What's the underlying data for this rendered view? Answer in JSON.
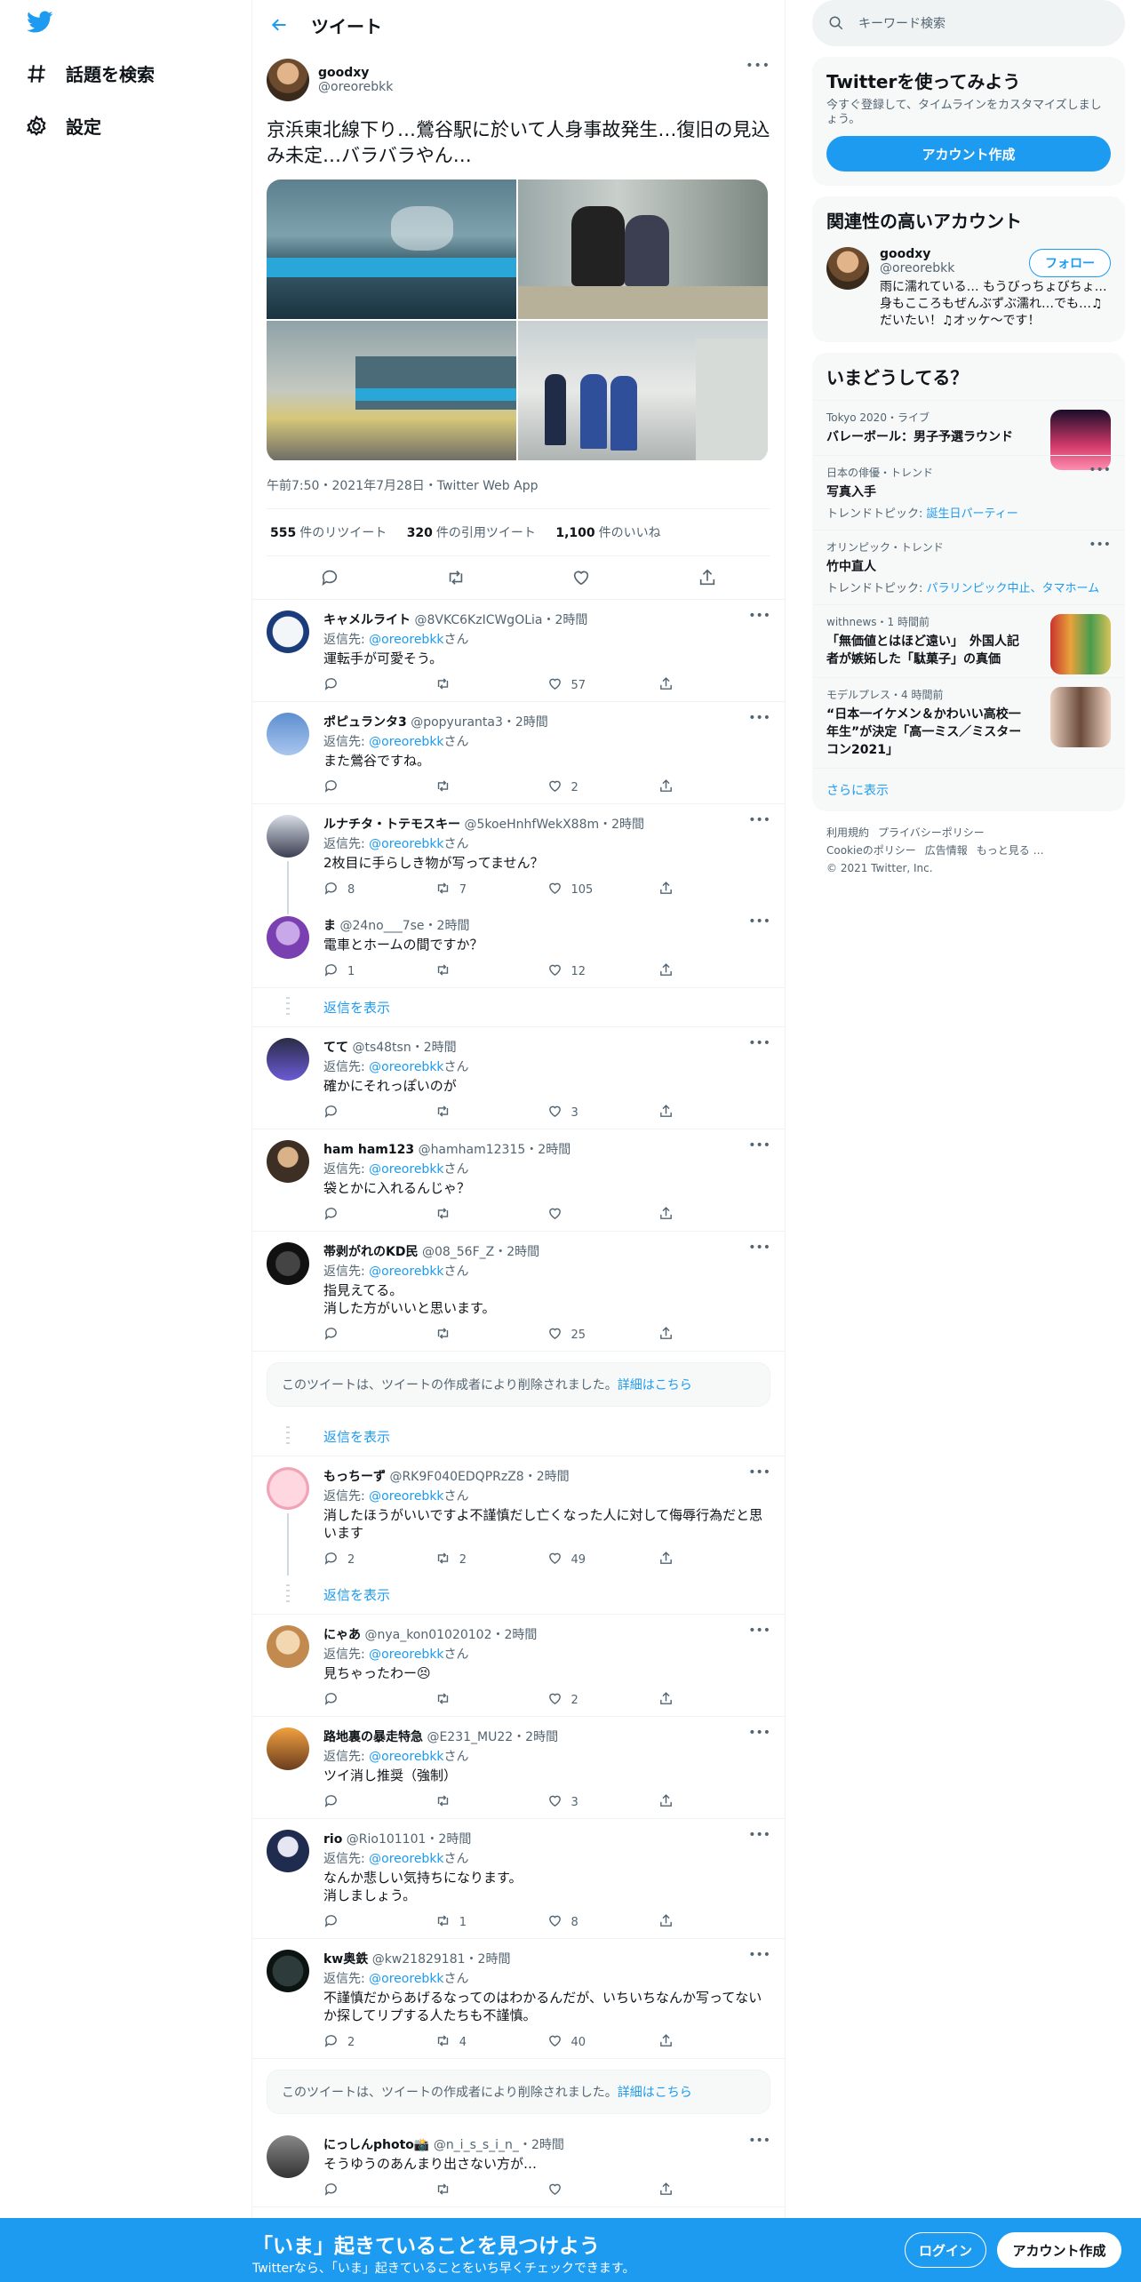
{
  "nav": {
    "logo": "twitter-bird-logo",
    "explore": "話題を検索",
    "settings": "設定"
  },
  "header": {
    "title": "ツイート"
  },
  "main_tweet": {
    "name": "goodxy",
    "handle": "@oreorebkk",
    "text": "京浜東北線下り…鶯谷駅に於いて人身事故発生…復旧の見込み未定…バラバラやん…",
    "time": "午前7:50・2021年7月28日・Twitter Web App",
    "stats": {
      "retweets_n": "555",
      "retweets_l": "件のリツイート",
      "quotes_n": "320",
      "quotes_l": "件の引用ツイート",
      "likes_n": "1,100",
      "likes_l": "件のいいね"
    }
  },
  "replies": [
    {
      "name": "キャメルライト",
      "handle": "@8VKC6KzICWgOLia",
      "time": "2時間",
      "to": "@oreorebkk",
      "text": "運転手が可愛そう。",
      "replies": "",
      "rts": "",
      "likes": "57"
    },
    {
      "name": "ポピュランタ3",
      "handle": "@popyuranta3",
      "time": "2時間",
      "to": "@oreorebkk",
      "text": "また鶯谷ですね。",
      "replies": "",
      "rts": "",
      "likes": "2"
    },
    {
      "name": "ルナチタ・トテモスキー",
      "handle": "@5koeHnhfWekX88m",
      "time": "2時間",
      "to": "@oreorebkk",
      "text": "2枚目に手らしき物が写ってません？",
      "replies": "8",
      "rts": "7",
      "likes": "105"
    },
    {
      "name": "ま",
      "handle": "@24no___7se",
      "time": "2時間",
      "to": "",
      "text": "電車とホームの間ですか？",
      "replies": "1",
      "rts": "",
      "likes": "12"
    },
    {
      "name": "てて",
      "handle": "@ts48tsn",
      "time": "2時間",
      "to": "@oreorebkk",
      "text": "確かにそれっぽいのが",
      "replies": "",
      "rts": "",
      "likes": "3"
    },
    {
      "name": "ham ham123",
      "handle": "@hamham12315",
      "time": "2時間",
      "to": "@oreorebkk",
      "text": "袋とかに入れるんじゃ？",
      "replies": "",
      "rts": "",
      "likes": ""
    },
    {
      "name": "帯剥がれのKD民",
      "handle": "@08_56F_Z",
      "time": "2時間",
      "to": "@oreorebkk",
      "text": "指見えてる。\n消した方がいいと思います。",
      "replies": "",
      "rts": "",
      "likes": "25"
    },
    {
      "name": "もっちーず",
      "handle": "@RK9F040EDQPRzZ8",
      "time": "2時間",
      "to": "@oreorebkk",
      "text": "消したほうがいいですよ不謹慎だし亡くなった人に対して侮辱行為だと思います",
      "replies": "2",
      "rts": "2",
      "likes": "49"
    },
    {
      "name": "にゃあ",
      "handle": "@nya_kon01020102",
      "time": "2時間",
      "to": "@oreorebkk",
      "text": "見ちゃったわー😣",
      "replies": "",
      "rts": "",
      "likes": "2"
    },
    {
      "name": "路地裏の暴走特急",
      "handle": "@E231_MU22",
      "time": "2時間",
      "to": "@oreorebkk",
      "text": "ツイ消し推奨（強制）",
      "replies": "",
      "rts": "",
      "likes": "3"
    },
    {
      "name": "rio",
      "handle": "@Rio101101",
      "time": "2時間",
      "to": "@oreorebkk",
      "text": "なんか悲しい気持ちになります。\n消しましょう。",
      "replies": "",
      "rts": "1",
      "likes": "8"
    },
    {
      "name": "kw奥鉄",
      "handle": "@kw21829181",
      "time": "2時間",
      "to": "@oreorebkk",
      "text": "不謹慎だからあげるなってのはわかるんだが、いちいちなんか写ってないか探してリプする人たちも不謹慎。",
      "replies": "2",
      "rts": "4",
      "likes": "40"
    },
    {
      "name": "にっしんphoto📸",
      "handle": "@n_i_s_s_i_n_",
      "time": "2時間",
      "to": "",
      "text": "そうゆうのあんまり出さない方が…",
      "replies": "",
      "rts": "",
      "likes": ""
    }
  ],
  "reply_prefix": "返信先: ",
  "reply_suffix": "さん",
  "show_replies": "返信を表示",
  "deleted": {
    "text": "このツイートは、ツイートの作成者により削除されました。",
    "link": "詳細はこちら"
  },
  "search": {
    "placeholder": "キーワード検索"
  },
  "promo": {
    "title": "Twitterを使ってみよう",
    "desc": "今すぐ登録して、タイムラインをカスタマイズしましょう。",
    "button": "アカウント作成"
  },
  "related": {
    "title": "関連性の高いアカウント",
    "name": "goodxy",
    "handle": "@oreorebkk",
    "bio": "雨に濡れている… もうびっちょびちょ…身もこころもぜんぶずぶ濡れ…でも…♫だいたい！♫オッケ〜です！",
    "follow": "フォロー"
  },
  "trends": {
    "title": "いまどうしてる？",
    "items": [
      {
        "meta": "Tokyo 2020・ライブ",
        "title": "バレーボール：男子予選ラウンド",
        "sub": "",
        "link": ""
      },
      {
        "meta": "日本の俳優・トレンド",
        "title": "写真入手",
        "sub": "トレンドトピック: ",
        "link": "誕生日パーティー"
      },
      {
        "meta": "オリンピック・トレンド",
        "title": "竹中直人",
        "sub": "トレンドトピック: ",
        "link": "パラリンピック中止、タマホーム"
      },
      {
        "meta": "withnews・1 時間前",
        "title": "「無価値とはほど遠い」　外国人記者が嫉妬した「駄菓子」の真価",
        "sub": "",
        "link": ""
      },
      {
        "meta": "モデルプレス・4 時間前",
        "title": "“日本一イケメン＆かわいい高校一年生”が決定「高一ミス／ミスターコン2021」",
        "sub": "",
        "link": ""
      }
    ],
    "more": "さらに表示"
  },
  "footer": {
    "terms": "利用規約",
    "privacy": "プライバシーポリシー",
    "cookie": "Cookieのポリシー",
    "ads": "広告情報",
    "more": "もっと見る …",
    "copy": "© 2021 Twitter, Inc."
  },
  "bottombar": {
    "title": "「いま」起きていることを見つけよう",
    "sub": "Twitterなら、「いま」起きていることをいち早くチェックできます。",
    "login": "ログイン",
    "signup": "アカウント作成"
  },
  "colors": {
    "accent": "#1d9bf0",
    "text": "#0f1419",
    "muted": "#536471"
  }
}
